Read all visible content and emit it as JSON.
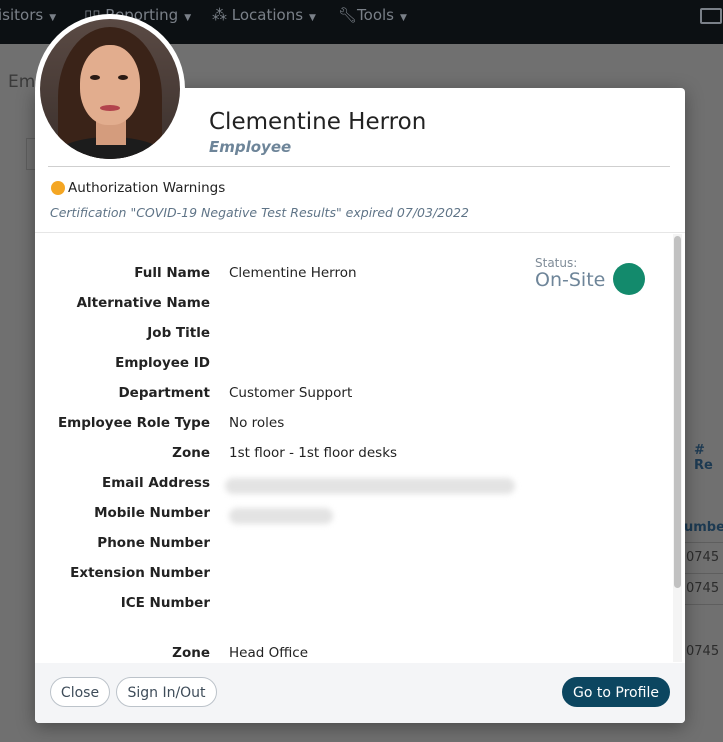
{
  "background": {
    "nav": {
      "visitors": "isitors",
      "reporting": "Reporting",
      "locations": "Locations",
      "tools": "Tools"
    },
    "page_title": "Em",
    "column_header_1": "# Re",
    "column_header_2": "umbe",
    "cells": [
      "0745",
      "0745",
      "0745"
    ]
  },
  "modal": {
    "name": "Clementine Herron",
    "role": "Employee",
    "warning_title": "Authorization Warnings",
    "warning_detail": "Certification \"COVID-19 Negative Test Results\" expired 07/03/2022",
    "status_label": "Status:",
    "status_value": "On-Site",
    "fields": [
      {
        "label": "Full Name",
        "value": "Clementine Herron"
      },
      {
        "label": "Alternative Name",
        "value": ""
      },
      {
        "label": "Job Title",
        "value": ""
      },
      {
        "label": "Employee ID",
        "value": ""
      },
      {
        "label": "Department",
        "value": "Customer Support"
      },
      {
        "label": "Employee Role Type",
        "value": "No roles"
      },
      {
        "label": "Zone",
        "value": "1st floor - 1st floor desks"
      },
      {
        "label": "Email Address",
        "value": ""
      },
      {
        "label": "Mobile Number",
        "value": ""
      },
      {
        "label": "Phone Number",
        "value": ""
      },
      {
        "label": "Extension Number",
        "value": ""
      },
      {
        "label": "ICE Number",
        "value": ""
      },
      {
        "label": "Zone",
        "value": "Head Office"
      }
    ],
    "buttons": {
      "close": "Close",
      "sign_in_out": "Sign In/Out",
      "go_to_profile": "Go to Profile"
    }
  },
  "colors": {
    "warning": "#f4a623",
    "status_on_site": "#138a6c",
    "primary_button": "#0c4660",
    "muted_blue": "#6e8599"
  },
  "icons": [
    "visitors-caret-icon",
    "reporting-chart-icon",
    "locations-nodes-icon",
    "tools-wrench-icon",
    "mail-icon",
    "warning-dot-icon",
    "status-dot-icon"
  ]
}
